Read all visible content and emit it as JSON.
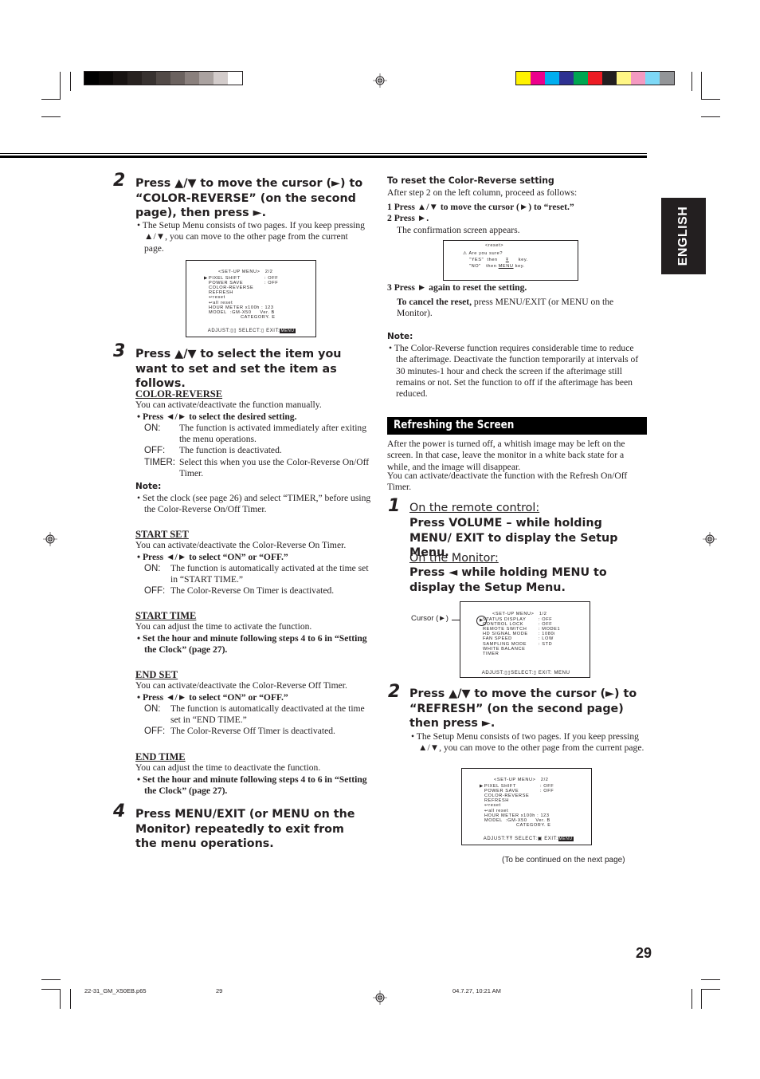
{
  "print_marks": {
    "grayscale_bar": [
      "#000000",
      "#0a0706",
      "#181312",
      "#282220",
      "#383230",
      "#524a47",
      "#6b625f",
      "#8a807d",
      "#aaa2a0",
      "#d3cccb",
      "#ffffff"
    ],
    "color_bar": [
      "#fff200",
      "#ec008c",
      "#00aeef",
      "#2e3192",
      "#00a651",
      "#ed1c24",
      "#231f20",
      "#fff685",
      "#f49ac1",
      "#7ed8f6",
      "#939598"
    ]
  },
  "language_tab": "ENGLISH",
  "left_column": {
    "step2": {
      "number": "2",
      "heading": "Press ▲/▼ to move the cursor (►) to “COLOR-REVERSE” (on the second page), then press ►.",
      "bullet": "The Setup Menu consists of two pages. If you keep pressing ▲/▼, you can move to the other page from the current page."
    },
    "osd_page2": {
      "title": "<SET-UP MENU>   2/2",
      "lines": [
        {
          "label": "PIXEL SHIFT",
          "value": ": OFF",
          "cursor": true
        },
        {
          "label": "POWER SAVE",
          "value": ": OFF"
        },
        {
          "label": "COLOR-REVERSE",
          "value": ""
        },
        {
          "label": "REFRESH",
          "value": ""
        },
        {
          "label": "↩reset",
          "value": ""
        },
        {
          "label": "↩all reset",
          "value": ""
        },
        {
          "label": "HOUR METER x100h : 123",
          "value": ""
        },
        {
          "label": "MODEL  :GM-X50     Ver. B",
          "value": ""
        },
        {
          "label": "CATEGORY. E",
          "value": ""
        }
      ],
      "footer": {
        "adjust": "ADJUST:",
        "select": "SELECT:",
        "exit": "EXIT:",
        "menu": "MENU"
      }
    },
    "step3": {
      "number": "3",
      "heading": "Press ▲/▼ to select the item you want to set and set the item as follows."
    },
    "sections": [
      {
        "title": "COLOR-REVERSE",
        "desc": "You can activate/deactivate the function manually.",
        "bullet": "Press ◄/► to select the desired setting.",
        "defs": [
          {
            "key": "ON:",
            "text": "The function is activated immediately after exiting the menu operations."
          },
          {
            "key": "OFF:",
            "text": "The function is deactivated."
          },
          {
            "key": "TIMER:",
            "text": "Select this when you use the Color-Reverse On/Off Timer."
          }
        ],
        "note_label": "Note:",
        "note": "Set the clock (see page 26) and select “TIMER,” before using the Color-Reverse On/Off Timer."
      },
      {
        "title": "START SET",
        "desc": "You can activate/deactivate the Color-Reverse On Timer.",
        "bullet": "Press ◄/► to select “ON” or “OFF.”",
        "defs": [
          {
            "key": "ON:",
            "text": "The function is automatically activated at the time set in “START TIME.”"
          },
          {
            "key": "OFF:",
            "text": "The Color-Reverse On Timer is deactivated."
          }
        ]
      },
      {
        "title": "START TIME",
        "desc": "You can adjust the time to activate the function.",
        "bullet": "Set the hour and minute following steps 4 to 6 in “Setting the Clock” (page 27)."
      },
      {
        "title": "END SET",
        "desc": "You can activate/deactivate the Color-Reverse Off Timer.",
        "bullet": "Press ◄/► to select “ON” or “OFF.”",
        "defs": [
          {
            "key": "ON:",
            "text": "The function is automatically deactivated at the time set in “END TIME.”"
          },
          {
            "key": "OFF:",
            "text": "The Color-Reverse Off Timer is deactivated."
          }
        ]
      },
      {
        "title": "END TIME",
        "desc": "You can adjust the time to deactivate the function.",
        "bullet": "Set the hour and minute following steps 4 to 6 in “Setting the Clock” (page 27)."
      }
    ],
    "step4": {
      "number": "4",
      "heading": "Press MENU/EXIT (or MENU on the Monitor) repeatedly to exit from the menu operations."
    }
  },
  "right_column": {
    "reset": {
      "title": "To reset the Color-Reverse setting",
      "intro": "After step 2 on the left column, proceed as follows:",
      "step1": "1  Press ▲/▼ to move the cursor (►) to “reset.”",
      "step2": "2  Press ►.",
      "step2_sub": "The confirmation screen appears.",
      "osd": {
        "title": "<reset>",
        "q": "Are you sure?",
        "yes": "\"YES\"  then",
        "yes_key": "key.",
        "no": "\"NO\"   then",
        "no_key_label": "MENU",
        "no_key": "key."
      },
      "step3": "3  Press ► again to reset the setting.",
      "cancel_bold": "To cancel the reset,",
      "cancel_rest": " press MENU/EXIT (or MENU on the Monitor).",
      "note_label": "Note:",
      "note": "The Color-Reverse function requires considerable time to reduce the afterimage. Deactivate the function temporarily at intervals of 30 minutes-1 hour and check the screen if the afterimage still remains or not. Set the function to off if the afterimage has been reduced."
    },
    "refresh": {
      "band_title": "Refreshing the Screen",
      "intro1": "After the power is turned off, a whitish image may be left on the screen. In that case, leave the monitor in a white back state for a while, and the image will disappear.",
      "intro2": "You can activate/deactivate the function with the Refresh On/Off Timer.",
      "step1": {
        "number": "1",
        "remote_label": "On the remote control:",
        "remote_text": "Press VOLUME – while holding MENU/ EXIT to display the Setup Menu.",
        "monitor_label": "On the Monitor:",
        "monitor_text": "Press ◄ while holding MENU to display the Setup Menu."
      },
      "cursor_callout": "Cursor (►)",
      "osd_page1": {
        "title": "<SET-UP MENU>   1/2",
        "lines": [
          {
            "label": "STATUS DISPLAY",
            "value": ": OFF"
          },
          {
            "label": "CONTROL LOCK",
            "value": ": OFF"
          },
          {
            "label": "REMOTE SWITCH",
            "value": ": MODE1"
          },
          {
            "label": "HD SIGNAL MODE",
            "value": ": 1080i"
          },
          {
            "label": "FAN SPEED",
            "value": ": LOW"
          },
          {
            "label": "SAMPLING MODE",
            "value": ": STD"
          },
          {
            "label": "WHITE BALANCE",
            "value": ""
          },
          {
            "label": "TIMER",
            "value": ""
          }
        ],
        "footer": {
          "adjust": "ADJUST:",
          "select": "SELECT:",
          "exit": "EXIT:",
          "menu": "MENU"
        }
      },
      "step2": {
        "number": "2",
        "heading": "Press ▲/▼ to move the cursor (►) to “REFRESH” (on the second page) then press ►.",
        "bullet": "The Setup Menu consists of two pages. If you keep pressing ▲/▼, you can move to the other page from the current page."
      },
      "continued": "(To be continued on the next page)"
    }
  },
  "page_number": "29",
  "footer": {
    "file": "22-31_GM_X50EB.p65",
    "page": "29",
    "timestamp": "04.7.27, 10:21 AM"
  }
}
